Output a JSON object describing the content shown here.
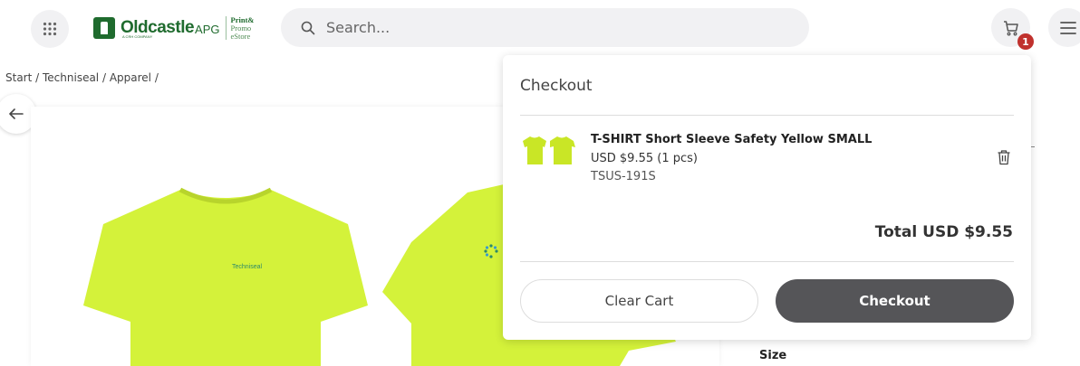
{
  "header": {
    "logo": {
      "name": "Oldcastle",
      "suffix": "APG",
      "tagline": "A CRH COMPANY",
      "sub_line1": "Print&",
      "sub_line2": "Promo",
      "sub_line3": "eStore"
    },
    "search": {
      "placeholder": "Search..."
    },
    "cart": {
      "count": "1"
    }
  },
  "breadcrumb": [
    "Start",
    "Techniseal",
    "Apparel"
  ],
  "product": {
    "shirt_brand": "Techniseal",
    "size_label": "Size"
  },
  "checkout": {
    "title": "Checkout",
    "item": {
      "name": "T-SHIRT Short Sleeve Safety Yellow SMALL",
      "price": "USD $9.55 (1 pcs)",
      "sku": "TSUS-191S"
    },
    "total_label": "Total",
    "total_value": "USD $9.55",
    "clear_button": "Clear Cart",
    "checkout_button": "Checkout"
  },
  "colors": {
    "brand_green": "#1f6b2e",
    "shirt_yellow": "#d4f23a",
    "badge_red": "#c0312d",
    "primary_button": "#555558"
  },
  "icons": {
    "apps": "apps-grid-icon",
    "search": "search-icon",
    "cart": "cart-icon",
    "menu": "hamburger-menu-icon",
    "back": "arrow-left-icon",
    "trash": "trash-icon"
  }
}
